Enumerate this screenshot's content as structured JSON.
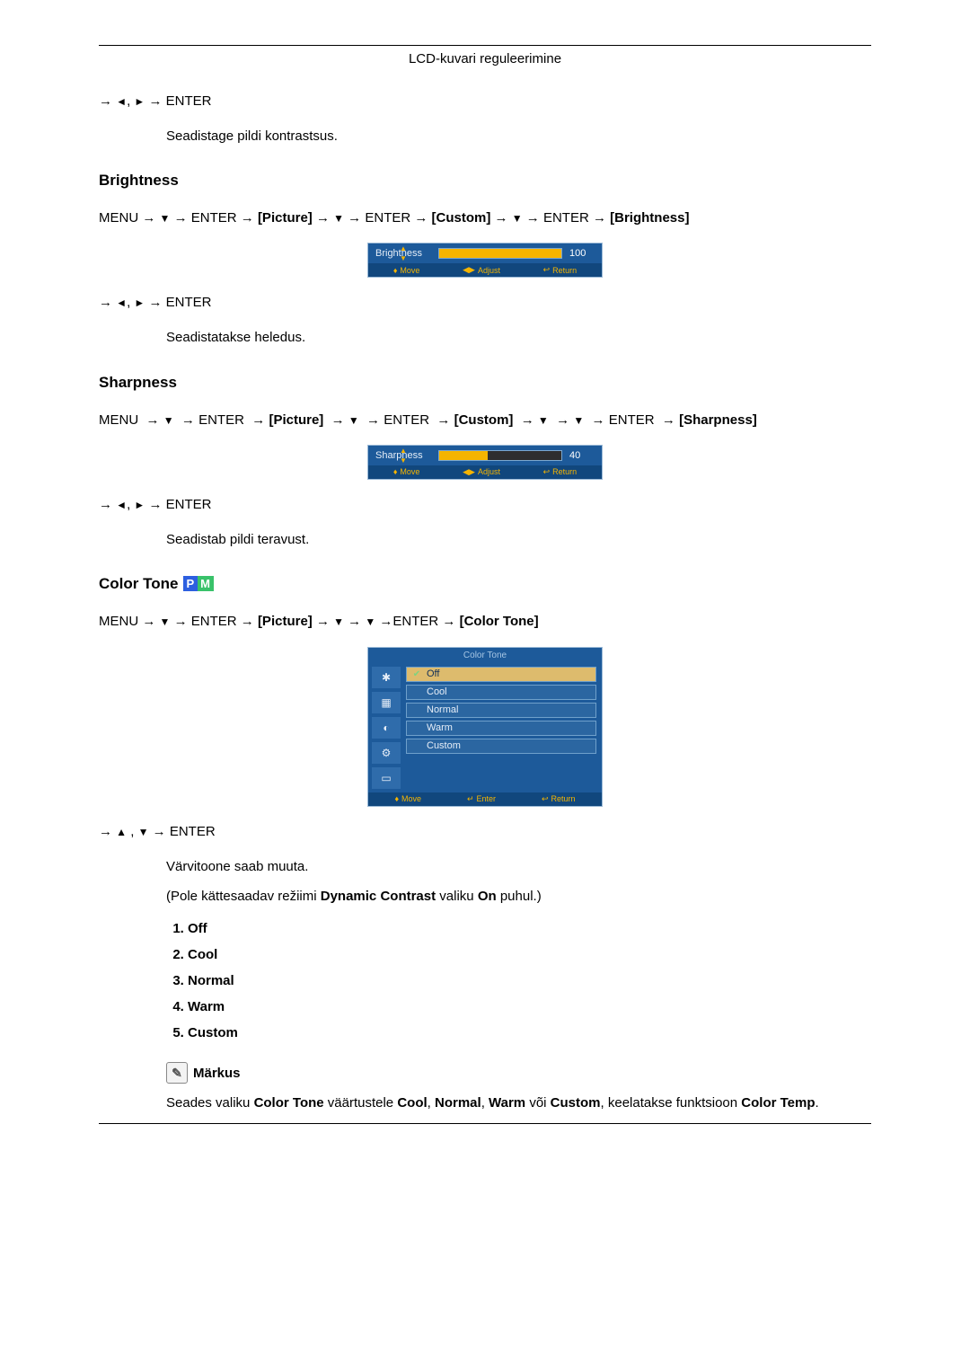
{
  "header": {
    "title": "LCD-kuvari reguleerimine"
  },
  "contrast_trail": {
    "nav_after": "ENTER",
    "desc": "Seadistage pildi kontrastsus."
  },
  "brightness": {
    "heading": "Brightness",
    "path_prefix": "MENU",
    "enter": "ENTER",
    "picture": "[Picture]",
    "custom": "[Custom]",
    "target": "[Brightness]",
    "osd_label": "Brightness",
    "osd_value": "100",
    "foot_move": "Move",
    "foot_adjust": "Adjust",
    "foot_return": "Return",
    "nav_after": "ENTER",
    "desc": "Seadistatakse heledus."
  },
  "sharpness": {
    "heading": "Sharpness",
    "path_prefix": "MENU",
    "enter": "ENTER",
    "picture": "[Picture]",
    "custom": "[Custom]",
    "target": "[Sharpness]",
    "osd_label": "Sharpness",
    "osd_value": "40",
    "foot_move": "Move",
    "foot_adjust": "Adjust",
    "foot_return": "Return",
    "nav_after": "ENTER",
    "desc": "Seadistab pildi teravust."
  },
  "colortone": {
    "heading": "Color Tone",
    "path_prefix": "MENU",
    "enter": "ENTER",
    "picture": "[Picture]",
    "target": "[Color Tone]",
    "osd_title": "Color Tone",
    "items": {
      "off": "Off",
      "cool": "Cool",
      "normal": "Normal",
      "warm": "Warm",
      "custom": "Custom"
    },
    "foot_move": "Move",
    "foot_enter": "Enter",
    "foot_return": "Return",
    "nav_after": "ENTER",
    "desc": "Värvitoone saab muuta.",
    "desc2_a": "(Pole kättesaadav režiimi ",
    "desc2_b": "Dynamic Contrast",
    "desc2_c": " valiku ",
    "desc2_d": "On",
    "desc2_e": " puhul.)",
    "list": {
      "1": "Off",
      "2": "Cool",
      "3": "Normal",
      "4": "Warm",
      "5": "Custom"
    },
    "note_label": "Märkus",
    "note_a": "Seades valiku ",
    "note_b": "Color Tone",
    "note_c": " väärtustele ",
    "note_d": "Cool",
    "note_e": "Normal",
    "note_f": "Warm",
    "note_g": "Custom",
    "note_h": ", keelatakse funktsioon ",
    "note_i": "Color Temp",
    "note_or": " või "
  }
}
